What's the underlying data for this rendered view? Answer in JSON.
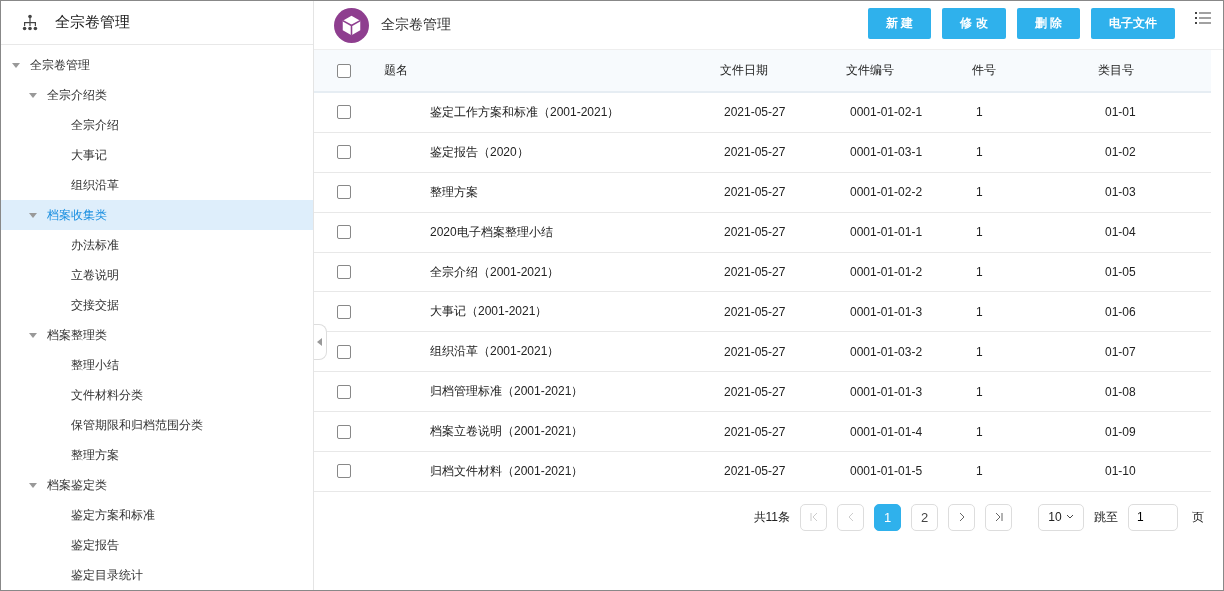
{
  "sidebar": {
    "title": "全宗卷管理",
    "tree": [
      {
        "label": "全宗卷管理",
        "expanded": true,
        "selected": false,
        "children": [
          {
            "label": "全宗介绍类",
            "expanded": true,
            "selected": false,
            "children": [
              {
                "label": "全宗介绍",
                "selected": false
              },
              {
                "label": "大事记",
                "selected": false
              },
              {
                "label": "组织沿革",
                "selected": false
              }
            ]
          },
          {
            "label": "档案收集类",
            "expanded": true,
            "selected": true,
            "children": [
              {
                "label": "办法标准",
                "selected": false
              },
              {
                "label": "立卷说明",
                "selected": false
              },
              {
                "label": "交接交据",
                "selected": false
              }
            ]
          },
          {
            "label": "档案整理类",
            "expanded": true,
            "selected": false,
            "children": [
              {
                "label": "整理小结",
                "selected": false
              },
              {
                "label": "文件材料分类",
                "selected": false
              },
              {
                "label": "保管期限和归档范围分类",
                "selected": false
              },
              {
                "label": "整理方案",
                "selected": false
              }
            ]
          },
          {
            "label": "档案鉴定类",
            "expanded": true,
            "selected": false,
            "children": [
              {
                "label": "鉴定方案和标准",
                "selected": false
              },
              {
                "label": "鉴定报告",
                "selected": false
              },
              {
                "label": "鉴定目录统计",
                "selected": false
              }
            ]
          }
        ]
      }
    ]
  },
  "header": {
    "title": "全宗卷管理",
    "buttons": [
      "新 建",
      "修 改",
      "删 除",
      "电子文件"
    ]
  },
  "table": {
    "columns": [
      "题名",
      "文件日期",
      "文件编号",
      "件号",
      "类目号"
    ],
    "header_checked": false,
    "rows": [
      {
        "checked": false,
        "cells": [
          "鉴定工作方案和标准（2001-2021）",
          "2021-05-27",
          "0001-01-02-1",
          "1",
          "01-01"
        ]
      },
      {
        "checked": false,
        "cells": [
          "鉴定报告（2020）",
          "2021-05-27",
          "0001-01-03-1",
          "1",
          "01-02"
        ]
      },
      {
        "checked": false,
        "cells": [
          "整理方案",
          "2021-05-27",
          "0001-01-02-2",
          "1",
          "01-03"
        ]
      },
      {
        "checked": false,
        "cells": [
          "2020电子档案整理小结",
          "2021-05-27",
          "0001-01-01-1",
          "1",
          "01-04"
        ]
      },
      {
        "checked": false,
        "cells": [
          "全宗介绍（2001-2021）",
          "2021-05-27",
          "0001-01-01-2",
          "1",
          "01-05"
        ]
      },
      {
        "checked": false,
        "cells": [
          "大事记（2001-2021）",
          "2021-05-27",
          "0001-01-01-3",
          "1",
          "01-06"
        ]
      },
      {
        "checked": false,
        "cells": [
          "组织沿革（2001-2021）",
          "2021-05-27",
          "0001-01-03-2",
          "1",
          "01-07"
        ]
      },
      {
        "checked": false,
        "cells": [
          "归档管理标准（2001-2021）",
          "2021-05-27",
          "0001-01-01-3",
          "1",
          "01-08"
        ]
      },
      {
        "checked": false,
        "cells": [
          "档案立卷说明（2001-2021）",
          "2021-05-27",
          "0001-01-01-4",
          "1",
          "01-09"
        ]
      },
      {
        "checked": false,
        "cells": [
          "归档文件材料（2001-2021）",
          "2021-05-27",
          "0001-01-01-5",
          "1",
          "01-10"
        ]
      }
    ]
  },
  "pagination": {
    "total": "共11条",
    "pages": [
      {
        "label": "1",
        "selected": true
      },
      {
        "label": "2",
        "selected": false
      }
    ],
    "page_size": "10",
    "jump_label": "跳至",
    "jump_value": "1",
    "page_unit": "页"
  }
}
